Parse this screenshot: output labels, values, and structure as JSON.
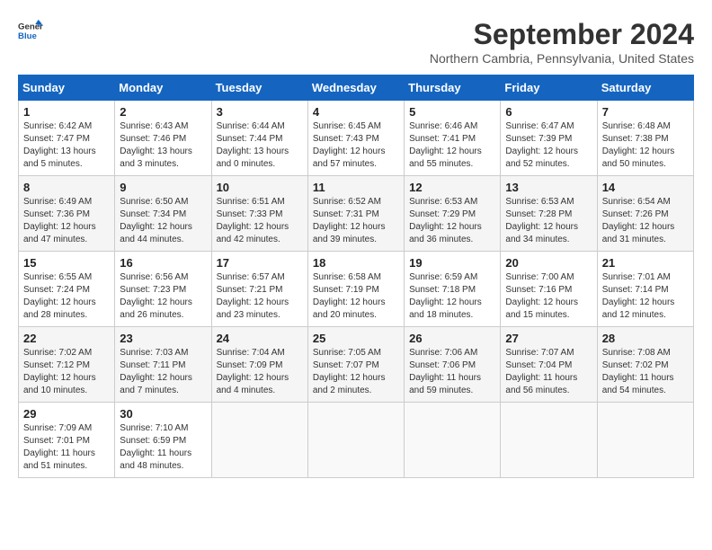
{
  "header": {
    "logo_line1": "General",
    "logo_line2": "Blue",
    "month_title": "September 2024",
    "subtitle": "Northern Cambria, Pennsylvania, United States"
  },
  "weekdays": [
    "Sunday",
    "Monday",
    "Tuesday",
    "Wednesday",
    "Thursday",
    "Friday",
    "Saturday"
  ],
  "weeks": [
    [
      {
        "day": "1",
        "sunrise": "6:42 AM",
        "sunset": "7:47 PM",
        "daylight": "13 hours and 5 minutes."
      },
      {
        "day": "2",
        "sunrise": "6:43 AM",
        "sunset": "7:46 PM",
        "daylight": "13 hours and 3 minutes."
      },
      {
        "day": "3",
        "sunrise": "6:44 AM",
        "sunset": "7:44 PM",
        "daylight": "13 hours and 0 minutes."
      },
      {
        "day": "4",
        "sunrise": "6:45 AM",
        "sunset": "7:43 PM",
        "daylight": "12 hours and 57 minutes."
      },
      {
        "day": "5",
        "sunrise": "6:46 AM",
        "sunset": "7:41 PM",
        "daylight": "12 hours and 55 minutes."
      },
      {
        "day": "6",
        "sunrise": "6:47 AM",
        "sunset": "7:39 PM",
        "daylight": "12 hours and 52 minutes."
      },
      {
        "day": "7",
        "sunrise": "6:48 AM",
        "sunset": "7:38 PM",
        "daylight": "12 hours and 50 minutes."
      }
    ],
    [
      {
        "day": "8",
        "sunrise": "6:49 AM",
        "sunset": "7:36 PM",
        "daylight": "12 hours and 47 minutes."
      },
      {
        "day": "9",
        "sunrise": "6:50 AM",
        "sunset": "7:34 PM",
        "daylight": "12 hours and 44 minutes."
      },
      {
        "day": "10",
        "sunrise": "6:51 AM",
        "sunset": "7:33 PM",
        "daylight": "12 hours and 42 minutes."
      },
      {
        "day": "11",
        "sunrise": "6:52 AM",
        "sunset": "7:31 PM",
        "daylight": "12 hours and 39 minutes."
      },
      {
        "day": "12",
        "sunrise": "6:53 AM",
        "sunset": "7:29 PM",
        "daylight": "12 hours and 36 minutes."
      },
      {
        "day": "13",
        "sunrise": "6:53 AM",
        "sunset": "7:28 PM",
        "daylight": "12 hours and 34 minutes."
      },
      {
        "day": "14",
        "sunrise": "6:54 AM",
        "sunset": "7:26 PM",
        "daylight": "12 hours and 31 minutes."
      }
    ],
    [
      {
        "day": "15",
        "sunrise": "6:55 AM",
        "sunset": "7:24 PM",
        "daylight": "12 hours and 28 minutes."
      },
      {
        "day": "16",
        "sunrise": "6:56 AM",
        "sunset": "7:23 PM",
        "daylight": "12 hours and 26 minutes."
      },
      {
        "day": "17",
        "sunrise": "6:57 AM",
        "sunset": "7:21 PM",
        "daylight": "12 hours and 23 minutes."
      },
      {
        "day": "18",
        "sunrise": "6:58 AM",
        "sunset": "7:19 PM",
        "daylight": "12 hours and 20 minutes."
      },
      {
        "day": "19",
        "sunrise": "6:59 AM",
        "sunset": "7:18 PM",
        "daylight": "12 hours and 18 minutes."
      },
      {
        "day": "20",
        "sunrise": "7:00 AM",
        "sunset": "7:16 PM",
        "daylight": "12 hours and 15 minutes."
      },
      {
        "day": "21",
        "sunrise": "7:01 AM",
        "sunset": "7:14 PM",
        "daylight": "12 hours and 12 minutes."
      }
    ],
    [
      {
        "day": "22",
        "sunrise": "7:02 AM",
        "sunset": "7:12 PM",
        "daylight": "12 hours and 10 minutes."
      },
      {
        "day": "23",
        "sunrise": "7:03 AM",
        "sunset": "7:11 PM",
        "daylight": "12 hours and 7 minutes."
      },
      {
        "day": "24",
        "sunrise": "7:04 AM",
        "sunset": "7:09 PM",
        "daylight": "12 hours and 4 minutes."
      },
      {
        "day": "25",
        "sunrise": "7:05 AM",
        "sunset": "7:07 PM",
        "daylight": "12 hours and 2 minutes."
      },
      {
        "day": "26",
        "sunrise": "7:06 AM",
        "sunset": "7:06 PM",
        "daylight": "11 hours and 59 minutes."
      },
      {
        "day": "27",
        "sunrise": "7:07 AM",
        "sunset": "7:04 PM",
        "daylight": "11 hours and 56 minutes."
      },
      {
        "day": "28",
        "sunrise": "7:08 AM",
        "sunset": "7:02 PM",
        "daylight": "11 hours and 54 minutes."
      }
    ],
    [
      {
        "day": "29",
        "sunrise": "7:09 AM",
        "sunset": "7:01 PM",
        "daylight": "11 hours and 51 minutes."
      },
      {
        "day": "30",
        "sunrise": "7:10 AM",
        "sunset": "6:59 PM",
        "daylight": "11 hours and 48 minutes."
      },
      null,
      null,
      null,
      null,
      null
    ]
  ]
}
